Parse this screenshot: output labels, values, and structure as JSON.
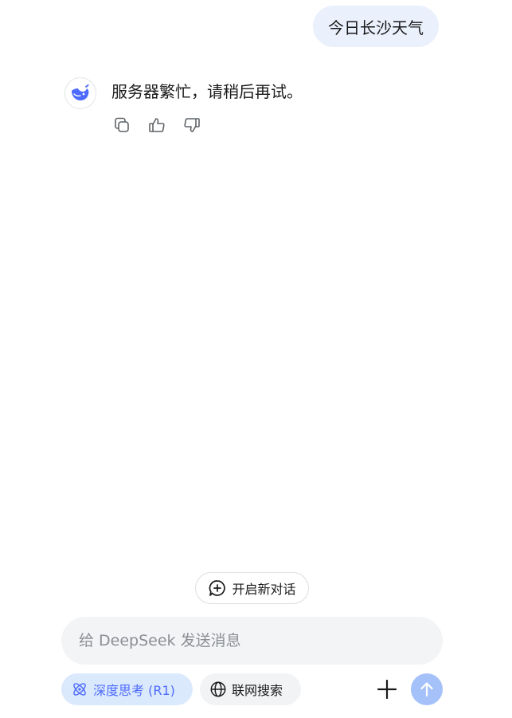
{
  "conversation": {
    "user_message": "今日长沙天气",
    "assistant_message": "服务器繁忙，请稍后再试。"
  },
  "message_actions": {
    "icons": [
      "copy-icon",
      "thumbs-up-icon",
      "thumbs-down-icon"
    ]
  },
  "new_chat": {
    "label": "开启新对话",
    "icon": "chat-plus-icon"
  },
  "composer": {
    "placeholder": "给 DeepSeek 发送消息",
    "value": ""
  },
  "toolbar": {
    "deep_think_label": "深度思考 (R1)",
    "web_search_label": "联网搜索",
    "deep_think_active": true
  },
  "colors": {
    "accent": "#4d6bfe",
    "user_bubble": "#eaf1fd",
    "deep_think_bg": "#dbe9fd",
    "send_button": "#a4c1f9",
    "input_bg": "#f3f4f6"
  }
}
